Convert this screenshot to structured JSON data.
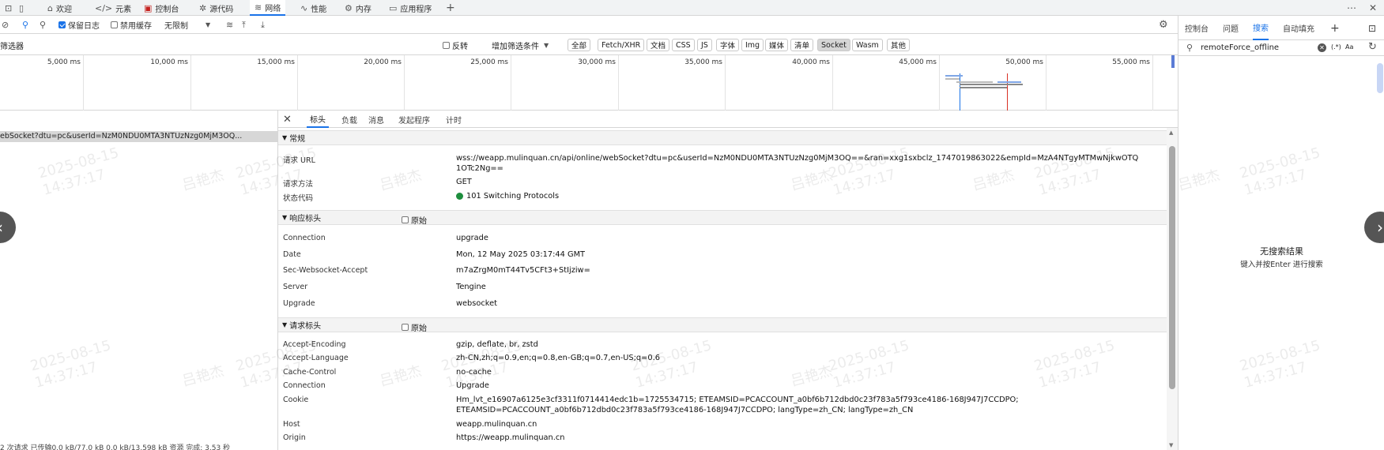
{
  "top_tabs": [
    {
      "label": "欢迎",
      "icon": "home-icon"
    },
    {
      "label": "元素",
      "icon": "code-icon"
    },
    {
      "label": "控制台",
      "icon": "console-icon"
    },
    {
      "label": "源代码",
      "icon": "bug-icon"
    },
    {
      "label": "网络",
      "icon": "wifi-icon"
    },
    {
      "label": "性能",
      "icon": "performance-icon"
    },
    {
      "label": "内存",
      "icon": "memory-icon"
    },
    {
      "label": "应用程序",
      "icon": "application-icon"
    }
  ],
  "toolbar": {
    "preserve_log": "保留日志",
    "disable_cache": "禁用缓存",
    "throttle": "无限制"
  },
  "filter": {
    "label": "筛选器",
    "invert": "反转",
    "more_filters": "增加筛选条件",
    "chips": [
      "全部",
      "Fetch/XHR",
      "文档",
      "CSS",
      "JS",
      "字体",
      "Img",
      "媒体",
      "清单",
      "Socket",
      "Wasm",
      "其他"
    ],
    "selected_chip": "Socket"
  },
  "timeline": {
    "ticks": [
      "5,000 ms",
      "10,000 ms",
      "15,000 ms",
      "20,000 ms",
      "25,000 ms",
      "30,000 ms",
      "35,000 ms",
      "40,000 ms",
      "45,000 ms",
      "50,000 ms",
      "55,000 ms"
    ]
  },
  "request_list": {
    "selected_row": "ebSocket?dtu=pc&userId=NzM0NDU0MTA3NTUzNzg0MjM3OQ...",
    "status_bar": "2 次请求  已传输0.0 kB/77.0 kB  0.0 kB/13,598 kB 资源  完成: 3.53 秒"
  },
  "detail_tabs": [
    "标头",
    "负载",
    "消息",
    "发起程序",
    "计时"
  ],
  "sections": {
    "general": {
      "title": "常规",
      "rows": [
        {
          "key": "请求 URL",
          "value": "wss://weapp.mulinquan.cn/api/online/webSocket?dtu=pc&userId=NzM0NDU0MTA3NTUzNzg0MjM3OQ==&ran=xxg1sxbclz_1747019863022&empId=MzA4NTgyMTMwNjkwOTQ",
          "value2": "1OTc2Ng=="
        },
        {
          "key": "请求方法",
          "value": "GET"
        },
        {
          "key": "状态代码",
          "value": "101 Switching Protocols"
        }
      ]
    },
    "response_headers": {
      "title": "响应标头",
      "raw": "原始",
      "rows": [
        {
          "key": "Connection",
          "value": "upgrade"
        },
        {
          "key": "Date",
          "value": "Mon, 12 May 2025 03:17:44 GMT"
        },
        {
          "key": "Sec-Websocket-Accept",
          "value": "m7aZrgM0mT44Tv5CFt3+StIjziw="
        },
        {
          "key": "Server",
          "value": "Tengine"
        },
        {
          "key": "Upgrade",
          "value": "websocket"
        }
      ]
    },
    "request_headers": {
      "title": "请求标头",
      "raw": "原始",
      "rows": [
        {
          "key": "Accept-Encoding",
          "value": "gzip, deflate, br, zstd"
        },
        {
          "key": "Accept-Language",
          "value": "zh-CN,zh;q=0.9,en;q=0.8,en-GB;q=0.7,en-US;q=0.6"
        },
        {
          "key": "Cache-Control",
          "value": "no-cache"
        },
        {
          "key": "Connection",
          "value": "Upgrade"
        },
        {
          "key": "Cookie",
          "value": "Hm_lvt_e16907a6125e3cf3311f0714414edc1b=1725534715; ETEAMSID=PCACCOUNT_a0bf6b712dbd0c23f783a5f793ce4186-168J947J7CCDPO;",
          "value2": "ETEAMSID=PCACCOUNT_a0bf6b712dbd0c23f783a5f793ce4186-168J947J7CCDPO; langType=zh_CN; langType=zh_CN"
        },
        {
          "key": "Host",
          "value": "weapp.mulinquan.cn"
        },
        {
          "key": "Origin",
          "value": "https://weapp.mulinquan.cn"
        }
      ]
    }
  },
  "sidebar": {
    "tabs": [
      "控制台",
      "问题",
      "搜索",
      "自动填充"
    ],
    "active_tab": "搜索",
    "search_value": "remoteForce_offline",
    "regex": "(.*)",
    "case": "Aa",
    "no_results": "无搜索结果",
    "hint": "键入并按Enter 进行搜索"
  },
  "watermark": {
    "name": "吕艳杰",
    "date": "2025-08-15",
    "time": "14:37:17"
  },
  "colors": {
    "accent": "#1a73e8",
    "status_ok": "#1e8e3e",
    "selected_row": "#d7d7d7"
  }
}
